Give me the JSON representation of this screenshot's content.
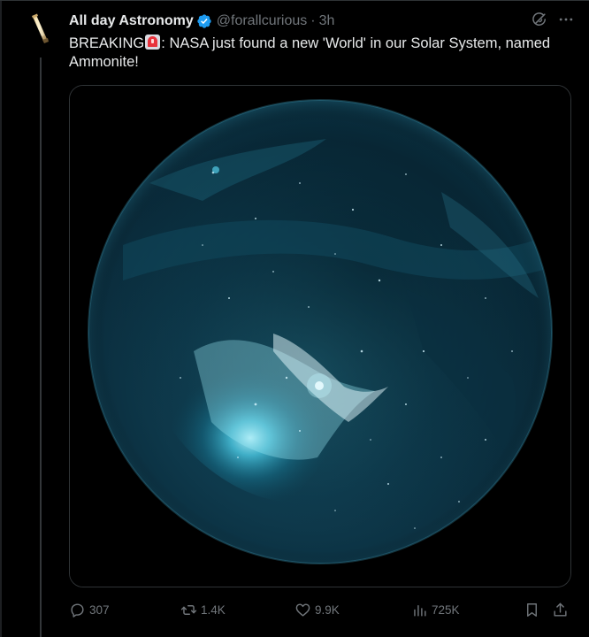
{
  "author": {
    "display_name": "All day Astronomy",
    "handle": "@forallcurious",
    "separator": "·",
    "time": "3h",
    "avatar_icon": "telescope-avatar-icon",
    "verified_icon": "verified-badge-icon"
  },
  "tweet": {
    "text_prefix": "BREAKING",
    "emoji_icon": "rotating-light-icon",
    "text_body": ": NASA just found a new 'World' in our Solar System, named Ammonite!"
  },
  "media": {
    "kind": "image",
    "subject_icon": "planet-image"
  },
  "header_actions": [
    {
      "icon": "grok-icon"
    },
    {
      "icon": "more-icon"
    }
  ],
  "engagement": {
    "replies": "307",
    "reposts": "1.4K",
    "likes": "9.9K",
    "views": "725K"
  },
  "colors": {
    "background": "#000000",
    "text": "#e7e9ea",
    "muted": "#71767b",
    "verified": "#1d9bf0",
    "border": "#2f3336"
  }
}
